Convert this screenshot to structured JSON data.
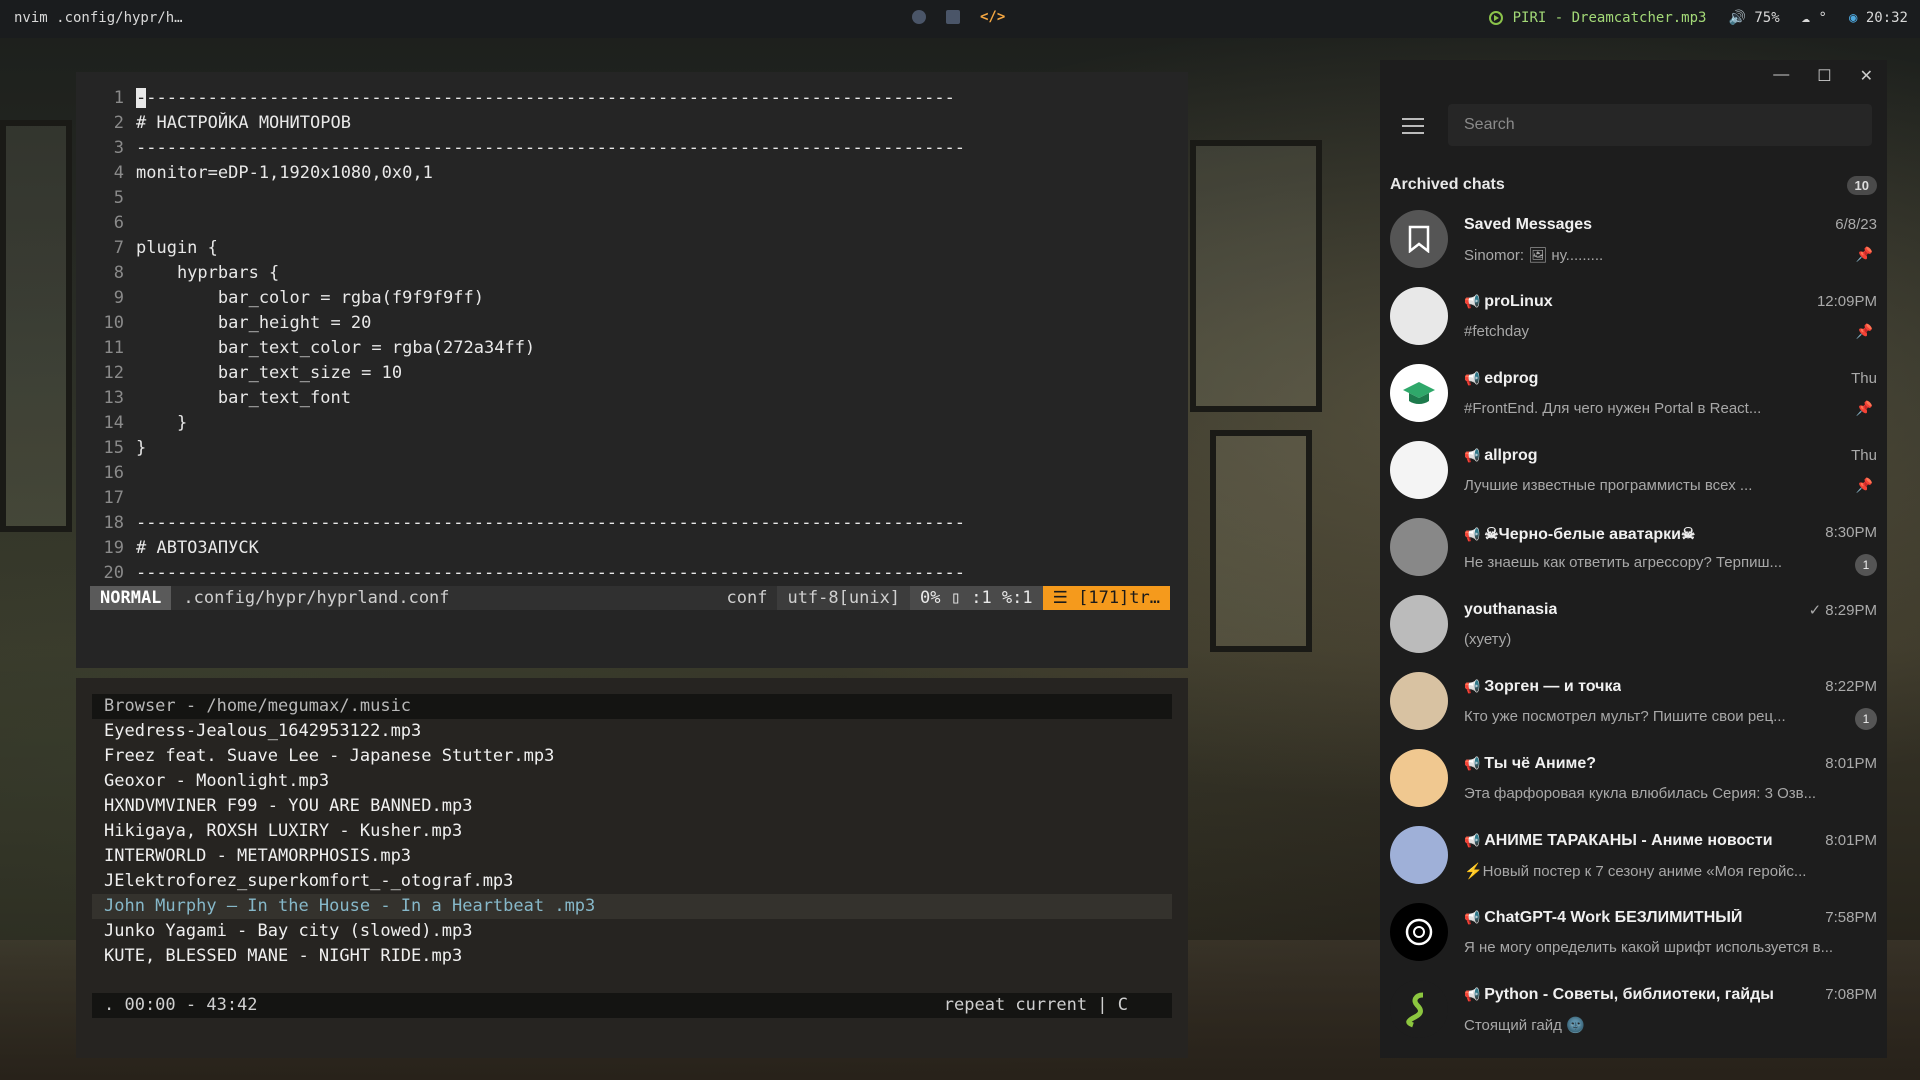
{
  "topbar": {
    "window_title": "nvim .config/hypr/h…",
    "workspaces": [
      "circle-icon",
      "square-icon",
      "code-icon"
    ],
    "track": "PIRI - Dreamcatcher.mp3",
    "volume": "75%",
    "weather": "°",
    "clock": "20:32",
    "accent": "#f5a742"
  },
  "nvim": {
    "lines": [
      {
        "n": "1",
        "t": "--------------------------------------------------------------------------------"
      },
      {
        "n": "2",
        "t": "# НАСТРОЙКА МОНИТОРОВ"
      },
      {
        "n": "3",
        "t": "---------------------------------------------------------------------------------"
      },
      {
        "n": "4",
        "t": "monitor=eDP-1,1920x1080,0x0,1"
      },
      {
        "n": "5",
        "t": ""
      },
      {
        "n": "6",
        "t": ""
      },
      {
        "n": "7",
        "t": "plugin {"
      },
      {
        "n": "8",
        "t": "    hyprbars {"
      },
      {
        "n": "9",
        "t": "        bar_color = rgba(f9f9f9ff)"
      },
      {
        "n": "10",
        "t": "        bar_height = 20"
      },
      {
        "n": "11",
        "t": "        bar_text_color = rgba(272a34ff)"
      },
      {
        "n": "12",
        "t": "        bar_text_size = 10"
      },
      {
        "n": "13",
        "t": "        bar_text_font"
      },
      {
        "n": "14",
        "t": "    }"
      },
      {
        "n": "15",
        "t": "}"
      },
      {
        "n": "16",
        "t": ""
      },
      {
        "n": "17",
        "t": ""
      },
      {
        "n": "18",
        "t": "---------------------------------------------------------------------------------"
      },
      {
        "n": "19",
        "t": "# АВТОЗАПУСК"
      },
      {
        "n": "20",
        "t": "---------------------------------------------------------------------------------"
      }
    ],
    "status": {
      "mode": "NORMAL",
      "file": ".config/hypr/hyprland.conf",
      "filetype": "conf",
      "encoding": "utf-8[unix]",
      "position": "0% ▯ :1 %:1",
      "warning": "☰ [171]tr…"
    }
  },
  "player": {
    "header": "Browser - /home/megumax/.music",
    "tracks": [
      "Eyedress-Jealous_1642953122.mp3",
      "Freez feat. Suave Lee - Japanese Stutter.mp3",
      "Geoxor - Moonlight.mp3",
      "HXNDVMVINER F99 - YOU ARE BANNED.mp3",
      "Hikigaya, ROXSH LUXIRY - Kusher.mp3",
      "INTERWORLD - METAMORPHOSIS.mp3",
      "JElektroforez_superkomfort_-_otograf.mp3",
      "John Murphy — In the House - In a Heartbeat .mp3",
      "Junko Yagami - Bay city (slowed).mp3",
      "KUTE, BLESSED MANE - NIGHT RIDE.mp3"
    ],
    "active_index": 7,
    "status_left": ". 00:00 - 43:42",
    "status_right": "repeat current | C"
  },
  "telegram": {
    "search_placeholder": "Search",
    "archived_label": "Archived chats",
    "archived_count": "10",
    "chats": [
      {
        "name": "Saved Messages",
        "time": "6/8/23",
        "msg": "Sinomor: 🖼 ну.........",
        "pinned": true,
        "unread": "",
        "avatar": "bookmark-icon",
        "avatar_bg": "#555555",
        "channel": false
      },
      {
        "name": "proLinux",
        "time": "12:09PM",
        "msg": "#fetchday",
        "pinned": true,
        "unread": "",
        "avatar": "robot-icon",
        "avatar_bg": "#e8e8e8",
        "channel": true
      },
      {
        "name": "edprog",
        "time": "Thu",
        "msg": "#FrontEnd. Для чего нужен Portal в React...",
        "pinned": true,
        "unread": "",
        "avatar": "cap-icon",
        "avatar_bg": "#ffffff",
        "channel": true
      },
      {
        "name": "allprog",
        "time": "Thu",
        "msg": "Лучшие известные программисты всех ...",
        "pinned": true,
        "unread": "",
        "avatar": "allprog-logo",
        "avatar_bg": "#f4f4f4",
        "channel": true
      },
      {
        "name": "☠Черно-белые аватарки☠",
        "time": "8:30PM",
        "msg": "Не знаешь как ответить агрессору? Терпиш...",
        "pinned": false,
        "unread": "1",
        "avatar": "bw-avatar",
        "avatar_bg": "#888888",
        "channel": true
      },
      {
        "name": "youthanasia",
        "time": "✓ 8:29PM",
        "msg": "(хуету)",
        "pinned": false,
        "unread": "",
        "avatar": "sketch-avatar",
        "avatar_bg": "#bbbbbb",
        "channel": false
      },
      {
        "name": "Зорген — и точка",
        "time": "8:22PM",
        "msg": "Кто уже посмотрел мульт? Пишите свои рец...",
        "pinned": false,
        "unread": "1",
        "avatar": "anime-boy-avatar",
        "avatar_bg": "#d8c2a2",
        "channel": true
      },
      {
        "name": "Ты чё Аниме?",
        "time": "8:01PM",
        "msg": "Эта фарфоровая кукла влюбилась Серия: 3 Озв...",
        "pinned": false,
        "unread": "",
        "avatar": "anime-girl-avatar",
        "avatar_bg": "#f0c890",
        "channel": true
      },
      {
        "name": "АНИМЕ ТАРАКАНЫ - Аниме новости",
        "time": "8:01PM",
        "msg": "⚡Новый постер к 7 сезону аниме «Моя геройс...",
        "pinned": false,
        "unread": "",
        "avatar": "colorful-avatar",
        "avatar_bg": "#9fb0d8",
        "channel": true
      },
      {
        "name": "ChatGPT-4 Work БЕЗЛИМИТНЫЙ",
        "time": "7:58PM",
        "msg": "Я не могу определить какой шрифт используется в...",
        "pinned": false,
        "unread": "",
        "avatar": "openai-logo",
        "avatar_bg": "#000000",
        "channel": true
      },
      {
        "name": "Python - Советы, библиотеки, гайды",
        "time": "7:08PM",
        "msg": "Стоящий гайд 🌚",
        "pinned": false,
        "unread": "",
        "avatar": "python-snake-avatar",
        "avatar_bg": "#1d1d1d",
        "channel": true
      }
    ]
  }
}
